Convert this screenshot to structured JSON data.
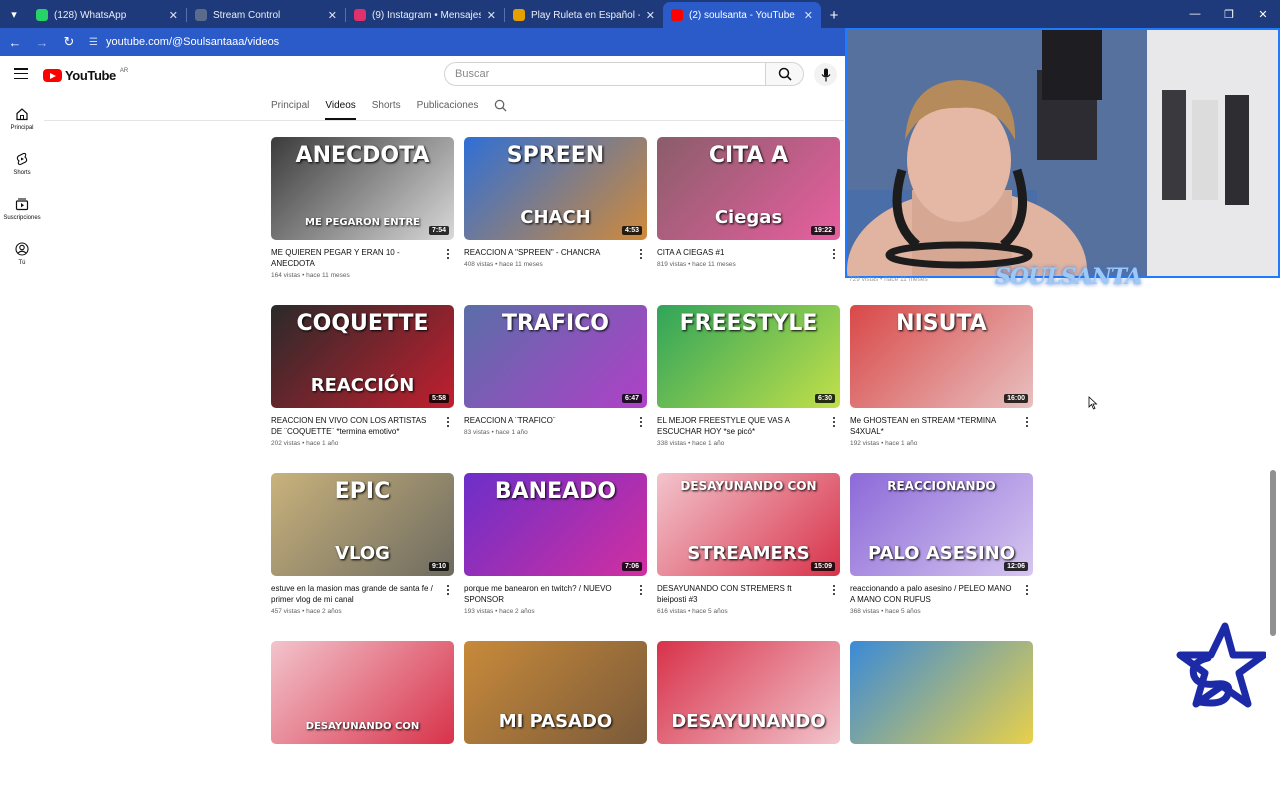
{
  "browser": {
    "tabs": [
      {
        "title": "(128) WhatsApp",
        "fav": "#25d366",
        "active": false
      },
      {
        "title": "Stream Control",
        "fav": "#5b6b8c",
        "active": false
      },
      {
        "title": "(9) Instagram • Mensajes",
        "fav": "#e1306c",
        "active": false
      },
      {
        "title": "Play Ruleta en Español - Roobet",
        "fav": "#e5a000",
        "active": false
      },
      {
        "title": "(2) soulsanta - YouTube",
        "fav": "#ff0000",
        "active": true
      }
    ],
    "url": "youtube.com/@Soulsantaaa/videos"
  },
  "youtube": {
    "logo_text": "YouTube",
    "country_code": "AR",
    "search_placeholder": "Buscar",
    "guide": [
      {
        "label": "Principal",
        "icon": "home-icon"
      },
      {
        "label": "Shorts",
        "icon": "shorts-icon"
      },
      {
        "label": "Suscripciones",
        "icon": "subscriptions-icon"
      },
      {
        "label": "Tú",
        "icon": "you-icon"
      }
    ],
    "channel_tabs": [
      "Principal",
      "Videos",
      "Shorts",
      "Publicaciones"
    ],
    "active_tab": "Videos"
  },
  "videos": [
    {
      "title": "ME QUIEREN PEGAR Y ERAN 10 - ANECDOTA",
      "info": "164 vistas • hace 11 meses",
      "duration": "7:54",
      "thumb_text": "ANECDOTA",
      "thumb_sub": "ME PEGARON ENTRE",
      "colors": [
        "#3b3b3b",
        "#d9d9d9"
      ]
    },
    {
      "title": "REACCION A \"SPREEN\" - CHANCRA",
      "info": "408 vistas • hace 11 meses",
      "duration": "4:53",
      "thumb_text": "SPREEN",
      "thumb_sub": "CHACH",
      "colors": [
        "#2f6fd6",
        "#d08a3a"
      ]
    },
    {
      "title": "CITA A CIEGAS #1",
      "info": "819 vistas • hace 11 meses",
      "duration": "19:22",
      "thumb_text": "CITA A",
      "thumb_sub": "Ciegas",
      "colors": [
        "#8a5d6a",
        "#e85fa0"
      ]
    },
    {
      "title": "",
      "info": "",
      "duration": "",
      "thumb_text": "",
      "thumb_sub": "",
      "colors": [
        "#ffffff",
        "#ffffff"
      ]
    },
    {
      "title": "REACCION EN VIVO CON LOS ARTISTAS DE ¨COQUETTE¨ *termina emotivo*",
      "info": "202 vistas • hace 1 año",
      "duration": "5:58",
      "thumb_text": "COQUETTE",
      "thumb_sub": "REACCIÓN",
      "colors": [
        "#2a2a2a",
        "#c21f2f"
      ]
    },
    {
      "title": "REACCION A ¨TRAFICO¨",
      "info": "83 vistas • hace 1 año",
      "duration": "6:47",
      "thumb_text": "TRAFICO",
      "thumb_sub": "",
      "colors": [
        "#5a6ea8",
        "#b040c8"
      ]
    },
    {
      "title": "EL MEJOR FREESTYLE QUE VAS A ESCUCHAR HOY *se picó*",
      "info": "338 vistas • hace 1 año",
      "duration": "6:30",
      "thumb_text": "FREESTYLE",
      "thumb_sub": "",
      "colors": [
        "#2fa45a",
        "#c2e04a"
      ]
    },
    {
      "title": "Me GHOSTEAN en STREAM *TERMINA S4XUAL*",
      "info": "192 vistas • hace 1 año",
      "duration": "16:00",
      "thumb_text": "NISUTA",
      "thumb_sub": "",
      "colors": [
        "#d94848",
        "#e8c0c0"
      ]
    },
    {
      "title": "estuve en la masion mas grande de santa fe / primer vlog de mi canal",
      "info": "457 vistas • hace 2 años",
      "duration": "9:10",
      "thumb_text": "EPIC",
      "thumb_sub": "VLOG",
      "colors": [
        "#c9b27c",
        "#6d6b60"
      ]
    },
    {
      "title": "porque me banearon en twitch? / NUEVO SPONSOR",
      "info": "193 vistas • hace 2 años",
      "duration": "7:06",
      "thumb_text": "BANEADO",
      "thumb_sub": "",
      "colors": [
        "#6b2fc9",
        "#d22fa0"
      ]
    },
    {
      "title": "DESAYUNANDO CON STREMERS ft bieiposti #3",
      "info": "616 vistas • hace 5 años",
      "duration": "15:09",
      "thumb_text": "DESAYUNANDO CON",
      "thumb_sub": "STREAMERS",
      "colors": [
        "#f2c4cc",
        "#d8324a"
      ]
    },
    {
      "title": "reaccionando a palo asesino / PELEO MANO A MANO CON RUFUS",
      "info": "368 vistas • hace 5 años",
      "duration": "12:06",
      "thumb_text": "REACCIONANDO",
      "thumb_sub": "PALO ASESINO",
      "colors": [
        "#8c6ad8",
        "#d6c6f0"
      ]
    },
    {
      "title": "",
      "info": "",
      "duration": "",
      "thumb_text": "",
      "thumb_sub": "DESAYUNANDO CON",
      "colors": [
        "#f2c4cc",
        "#d8324a"
      ]
    },
    {
      "title": "",
      "info": "",
      "duration": "",
      "thumb_text": "",
      "thumb_sub": "MI PASADO",
      "colors": [
        "#c88a3a",
        "#7a5a3a"
      ]
    },
    {
      "title": "",
      "info": "",
      "duration": "",
      "thumb_text": "",
      "thumb_sub": "DESAYUNANDO",
      "colors": [
        "#d8324a",
        "#f2c4cc"
      ]
    },
    {
      "title": "",
      "info": "",
      "duration": "",
      "thumb_text": "",
      "thumb_sub": "",
      "colors": [
        "#3a8ad8",
        "#e8d04a"
      ]
    }
  ],
  "overlay": {
    "partial_info": "729 vistas • hace 11 meses",
    "streamer_name": "SOULSANTA"
  }
}
